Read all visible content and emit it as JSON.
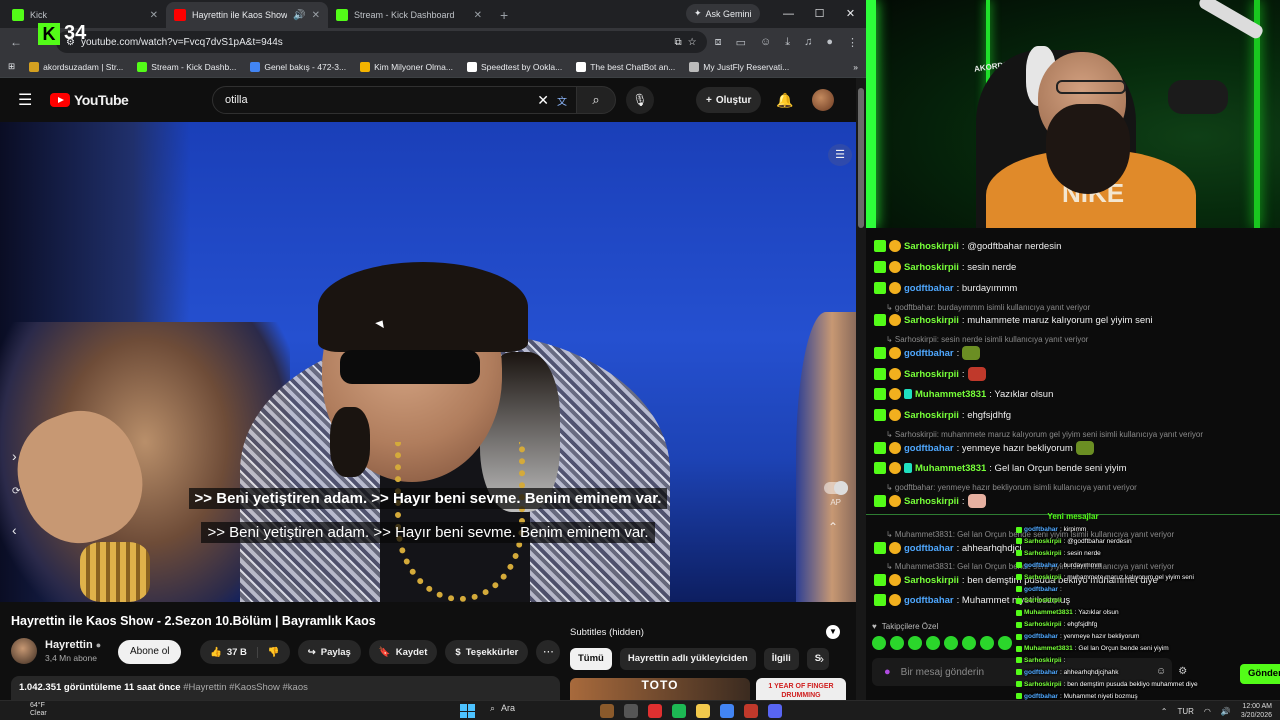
{
  "browser": {
    "tabs": [
      {
        "title": "Kick",
        "color": "#53fc18"
      },
      {
        "title": "Hayrettin ile Kaos Show - 2",
        "color": "#ff0000"
      },
      {
        "title": "Stream - Kick Dashboard",
        "color": "#53fc18"
      }
    ],
    "gemini_label": "Ask Gemini",
    "url": "youtube.com/watch?v=Fvcq7dvS1pA&t=944s",
    "overlay_count": "34",
    "bookmarks": [
      {
        "label": "akordsuzadam | Str...",
        "color": "#d4a020"
      },
      {
        "label": "Stream - Kick Dashb...",
        "color": "#53fc18"
      },
      {
        "label": "Genel bakış - 472-3...",
        "color": "#4285f4"
      },
      {
        "label": "Kim Milyoner Olma...",
        "color": "#f4b400"
      },
      {
        "label": "Speedtest by Ookla...",
        "color": "#ffffff"
      },
      {
        "label": "The best ChatBot an...",
        "color": "#ffffff"
      },
      {
        "label": "My JustFly Reservati...",
        "color": "#bbbbbb"
      }
    ]
  },
  "youtube": {
    "logo_text": "YouTube",
    "search_value": "otilla",
    "create_label": "Oluştur",
    "captions": [
      ">> Beni yetiştiren adam. >> Hayır beni sevme. Benim eminem var.",
      ">> Beni yetiştiren adam. >> Hayır beni sevme. Benim eminem var."
    ],
    "ap_label": "AP",
    "video_title": "Hayrettin ile Kaos Show - 2.Sezon 10.Bölüm | Bayramlık Kaos",
    "channel_name": "Hayrettin",
    "channel_subs": "3,4 Mn abone",
    "subscribe_label": "Abone ol",
    "like_count": "37 B",
    "share_label": "Paylaş",
    "save_label": "Kaydet",
    "thanks_label": "Teşekkürler",
    "views": "1.042.351 görüntüleme",
    "uploaded": "11 saat önce",
    "hashtags": "#Hayrettin #KaosShow #kaos",
    "subtitles_label": "Subtitles (hidden)",
    "chips": [
      "Tümü",
      "Hayrettin adlı yükleyiciden",
      "İlgili",
      "S"
    ],
    "thumb_texts": [
      "TOTO",
      "1 YEAR OF FINGER DRUMMING"
    ]
  },
  "cam": {
    "shirt_text": "NIKE",
    "sign_text": "AKORDSZ"
  },
  "chat": {
    "messages": [
      {
        "kind": "msg",
        "user": "Sarhoskirpii",
        "uclass": "a",
        "text": ": @godftbahar nerdesin",
        "badges": "gy"
      },
      {
        "kind": "msg",
        "user": "Sarhoskirpii",
        "uclass": "a",
        "text": ": sesin nerde",
        "badges": "gy"
      },
      {
        "kind": "msg",
        "user": "godftbahar",
        "uclass": "b",
        "text": ": burdayımmm",
        "badges": "gy"
      },
      {
        "kind": "reply",
        "text": "↳ godftbahar: burdayımmm isimli kullanıcıya yanıt veriyor"
      },
      {
        "kind": "msg",
        "user": "Sarhoskirpii",
        "uclass": "a",
        "text": ": muhammete maruz kalıyorum gel yiyim seni",
        "badges": "gy"
      },
      {
        "kind": "reply",
        "text": "↳ Sarhoskirpii: sesin nerde isimli kullanıcıya yanıt veriyor"
      },
      {
        "kind": "msg",
        "user": "godftbahar",
        "uclass": "b",
        "text": ":",
        "badges": "gy",
        "emote": "#6b8e23"
      },
      {
        "kind": "msg",
        "user": "Sarhoskirpii",
        "uclass": "a",
        "text": ":",
        "badges": "gy",
        "emote": "#c0392b"
      },
      {
        "kind": "msg",
        "user": "Muhammet3831",
        "uclass": "a",
        "text": ": Yazıklar olsun",
        "badges": "gyt"
      },
      {
        "kind": "msg",
        "user": "Sarhoskirpii",
        "uclass": "a",
        "text": ": ehgfsjdhfg",
        "badges": "gy"
      },
      {
        "kind": "reply",
        "text": "↳ Sarhoskirpii: muhammete maruz kalıyorum gel yiyim seni isimli kullanıcıya yanıt veriyor"
      },
      {
        "kind": "msg",
        "user": "godftbahar",
        "uclass": "b",
        "text": ": yenmeye hazır bekliyorum",
        "badges": "gy",
        "emote": "#6b8e23"
      },
      {
        "kind": "msg",
        "user": "Muhammet3831",
        "uclass": "a",
        "text": ": Gel lan Orçun bende seni yiyim",
        "badges": "gyt"
      },
      {
        "kind": "reply",
        "text": "↳ godftbahar: yenmeye hazır bekliyorum isimli kullanıcıya yanıt veriyor"
      },
      {
        "kind": "msg",
        "user": "Sarhoskirpii",
        "uclass": "a",
        "text": ":",
        "badges": "gy",
        "emote": "#e6b0a0"
      }
    ],
    "new_messages_label": "Yeni mesajlar",
    "lower_messages": [
      {
        "kind": "reply",
        "text": "↳ Muhammet3831: Gel lan Orçun bende seni yiyim isimli kullanıcıya yanıt veriyor"
      },
      {
        "kind": "msg",
        "user": "godftbahar",
        "uclass": "b",
        "text": ": ahhearhqhdjcj",
        "badges": "gy"
      },
      {
        "kind": "reply",
        "text": "↳ Muhammet3831: Gel lan Orçun bende seni yiyim isimli kullanıcıya yanıt veriyor"
      },
      {
        "kind": "msg",
        "user": "Sarhoskirpii",
        "uclass": "a",
        "text": ": ben demştim pusuda bekliyo muhammet diye",
        "badges": "gy"
      },
      {
        "kind": "msg",
        "user": "godftbahar",
        "uclass": "b",
        "text": ": Muhammet niyeti bozmuş",
        "badges": "gy"
      }
    ],
    "followers_label": "Takipçilere Özel",
    "input_placeholder": "Bir mesaj gönderin",
    "send_label": "Gönder"
  },
  "overlay_chat": [
    {
      "user": "godftbahar",
      "uclass": "b",
      "text": ": kirpimm"
    },
    {
      "user": "Sarhoskirpii",
      "uclass": "a",
      "text": ": @godftbahar nerdesin"
    },
    {
      "user": "Sarhoskirpii",
      "uclass": "a",
      "text": ": sesin nerde"
    },
    {
      "user": "godftbahar",
      "uclass": "b",
      "text": ": burdayımmm"
    },
    {
      "user": "Sarhoskirpii",
      "uclass": "a",
      "text": ": muhammete maruz kalıyorum gel yiyim seni"
    },
    {
      "user": "godftbahar",
      "uclass": "b",
      "text": ":"
    },
    {
      "user": "Sarhoskirpii",
      "uclass": "a",
      "text": ":"
    },
    {
      "user": "Muhammet3831",
      "uclass": "a",
      "text": ": Yazıklar olsun"
    },
    {
      "user": "Sarhoskirpii",
      "uclass": "a",
      "text": ": ehgfsjdhfg"
    },
    {
      "user": "godftbahar",
      "uclass": "b",
      "text": ": yenmeye hazır bekliyorum"
    },
    {
      "user": "Muhammet3831",
      "uclass": "a",
      "text": ": Gel lan Orçun bende seni yiyim"
    },
    {
      "user": "Sarhoskirpii",
      "uclass": "a",
      "text": ":"
    },
    {
      "user": "godftbahar",
      "uclass": "b",
      "text": ": ahhearhqhdjcjhahk"
    },
    {
      "user": "Sarhoskirpii",
      "uclass": "a",
      "text": ": ben demştim pusuda bekliyo muhammet diye"
    },
    {
      "user": "godftbahar",
      "uclass": "b",
      "text": ": Muhammet niyeti bozmuş"
    }
  ],
  "taskbar": {
    "temp": "64°F",
    "weather": "Clear",
    "search": "Ara",
    "lang": "TUR",
    "time": "12:00 AM",
    "date": "3/20/2026",
    "app_colors": [
      "#8b5a2b",
      "#555555",
      "#e03030",
      "#1db954",
      "#f2c94c",
      "#4285f4",
      "#c0392b",
      "#5865f2"
    ]
  }
}
